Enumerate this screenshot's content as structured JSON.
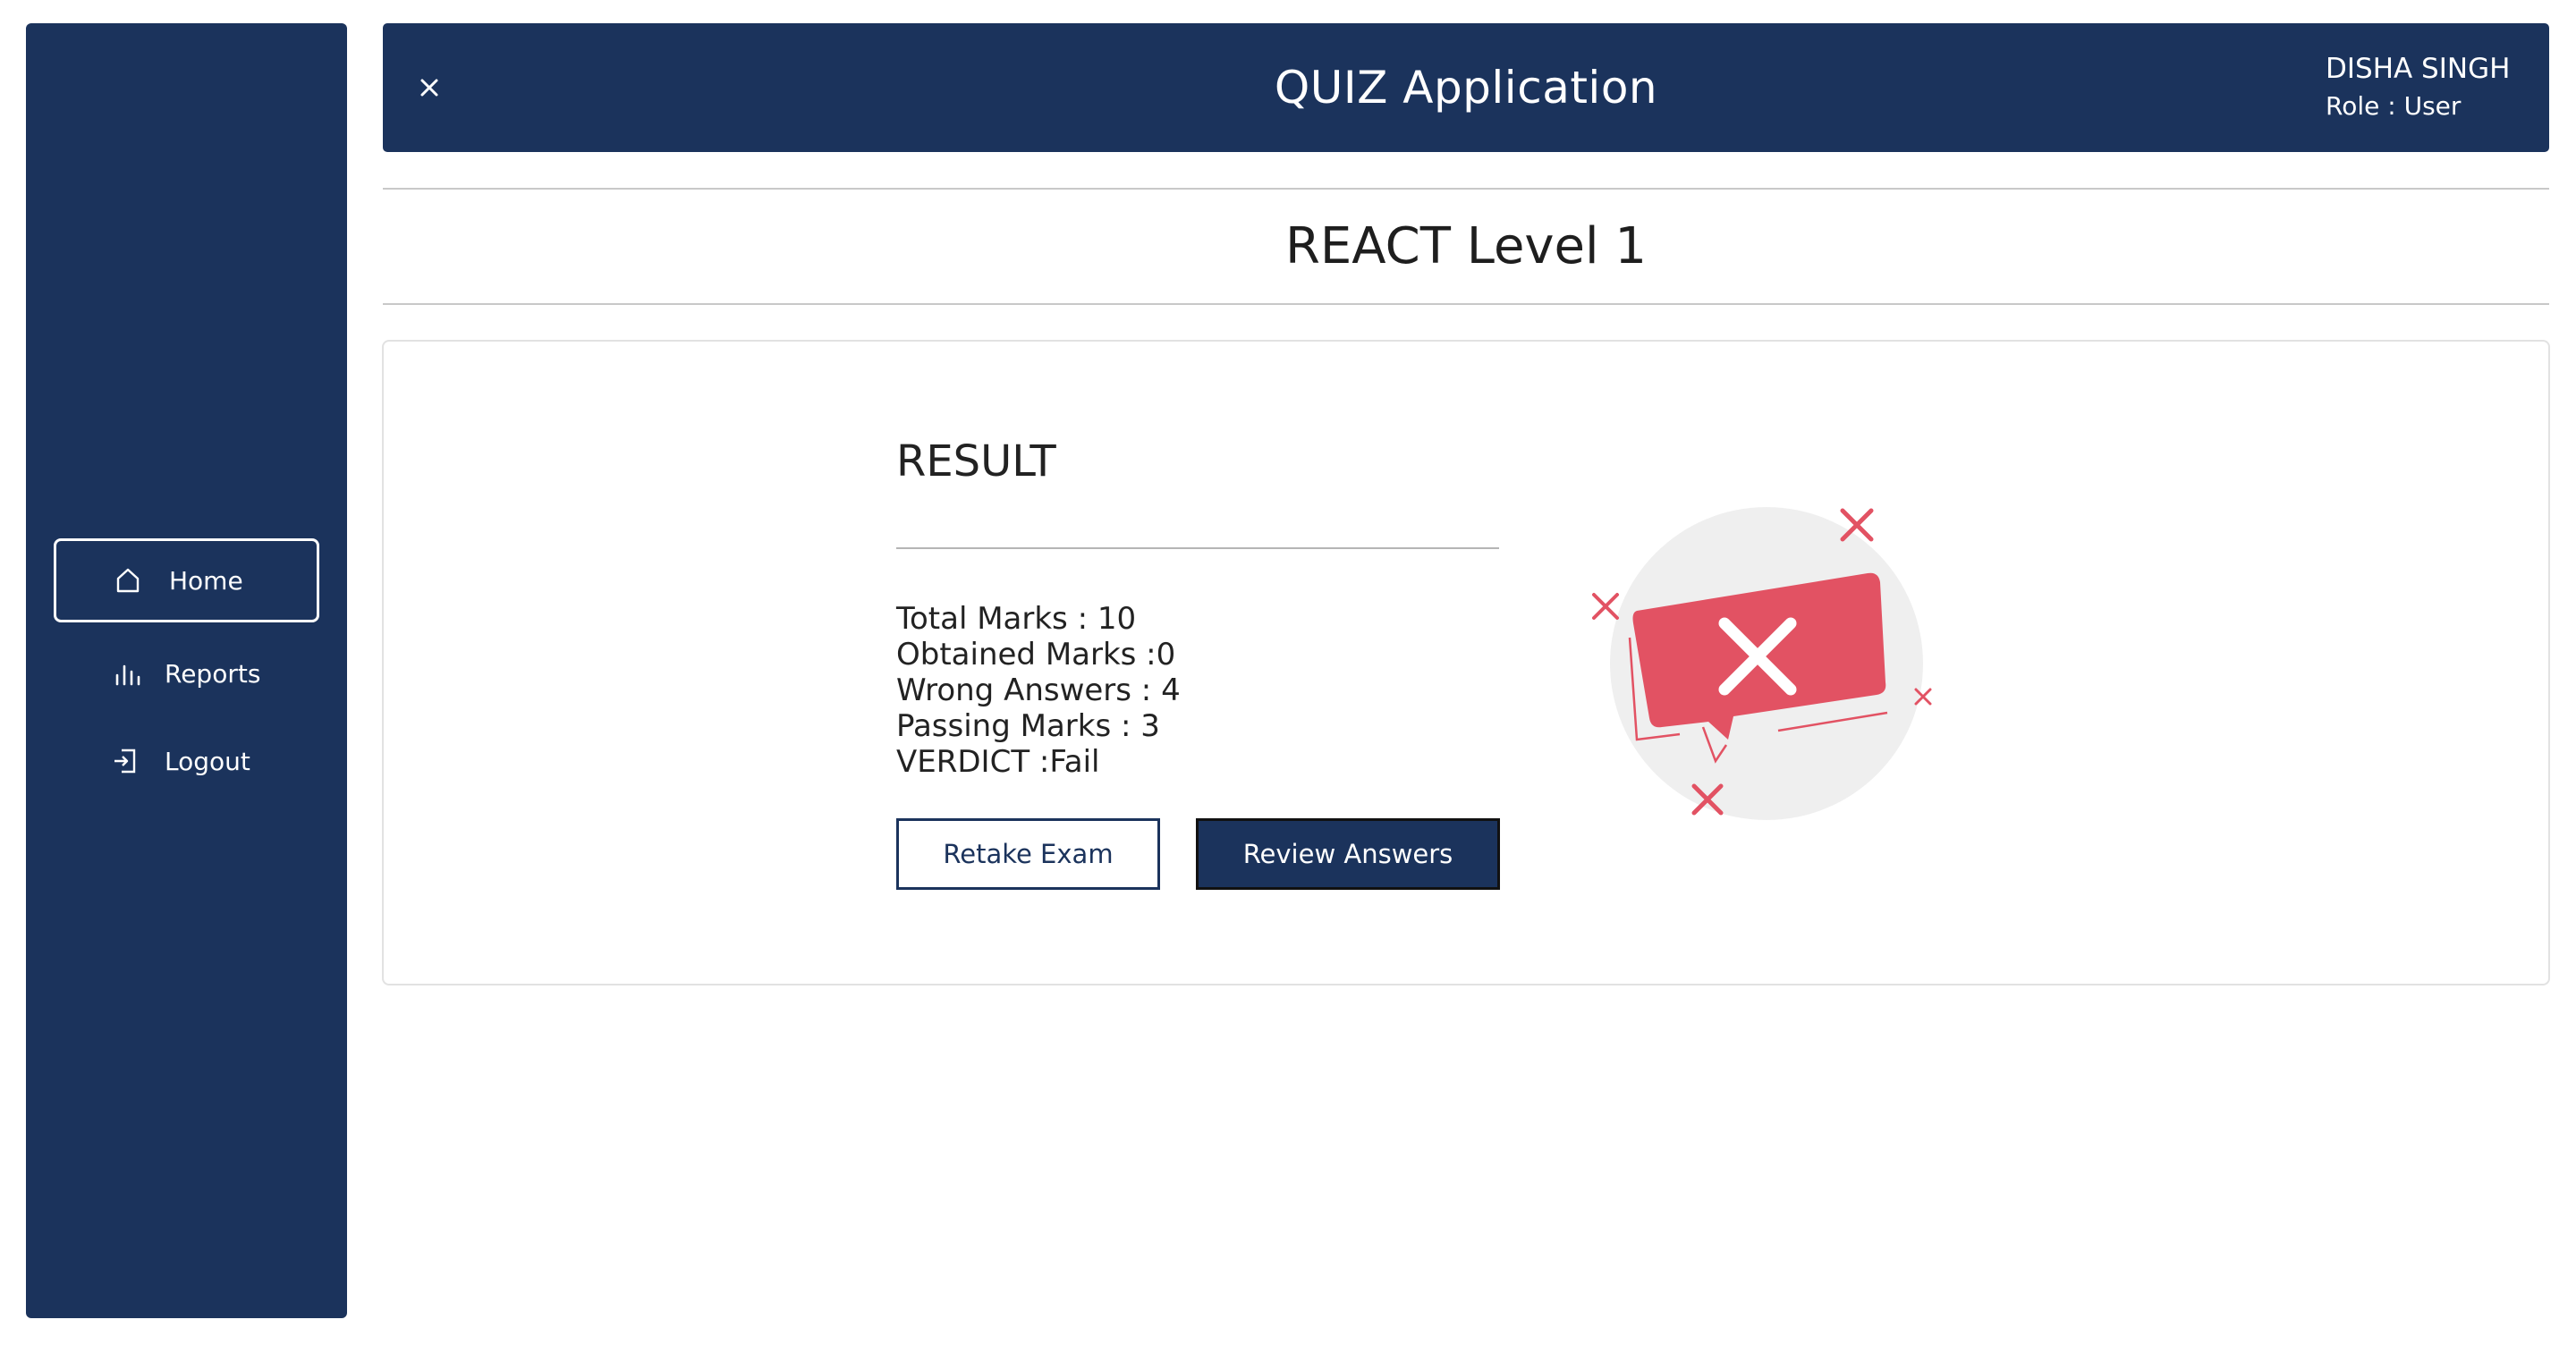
{
  "sidebar": {
    "items": [
      {
        "label": "Home",
        "icon": "home-icon",
        "active": true
      },
      {
        "label": "Reports",
        "icon": "bar-chart-icon",
        "active": false
      },
      {
        "label": "Logout",
        "icon": "logout-icon",
        "active": false
      }
    ]
  },
  "header": {
    "close_icon": "close-icon",
    "title": "QUIZ Application",
    "user_name": "DISHA SINGH",
    "user_role": "Role : User"
  },
  "quiz": {
    "title": "REACT Level 1"
  },
  "result": {
    "heading": "RESULT",
    "stats": [
      "Total Marks : 10",
      "Obtained Marks :0",
      "Wrong Answers : 4",
      "Passing Marks : 3",
      "VERDICT :Fail"
    ],
    "retake_label": "Retake Exam",
    "review_label": "Review Answers",
    "illustration_icon": "failed-result-illustration"
  },
  "colors": {
    "primary": "#1b335c",
    "accent_fail": "#e25263",
    "illustration_bg": "#efefef"
  }
}
